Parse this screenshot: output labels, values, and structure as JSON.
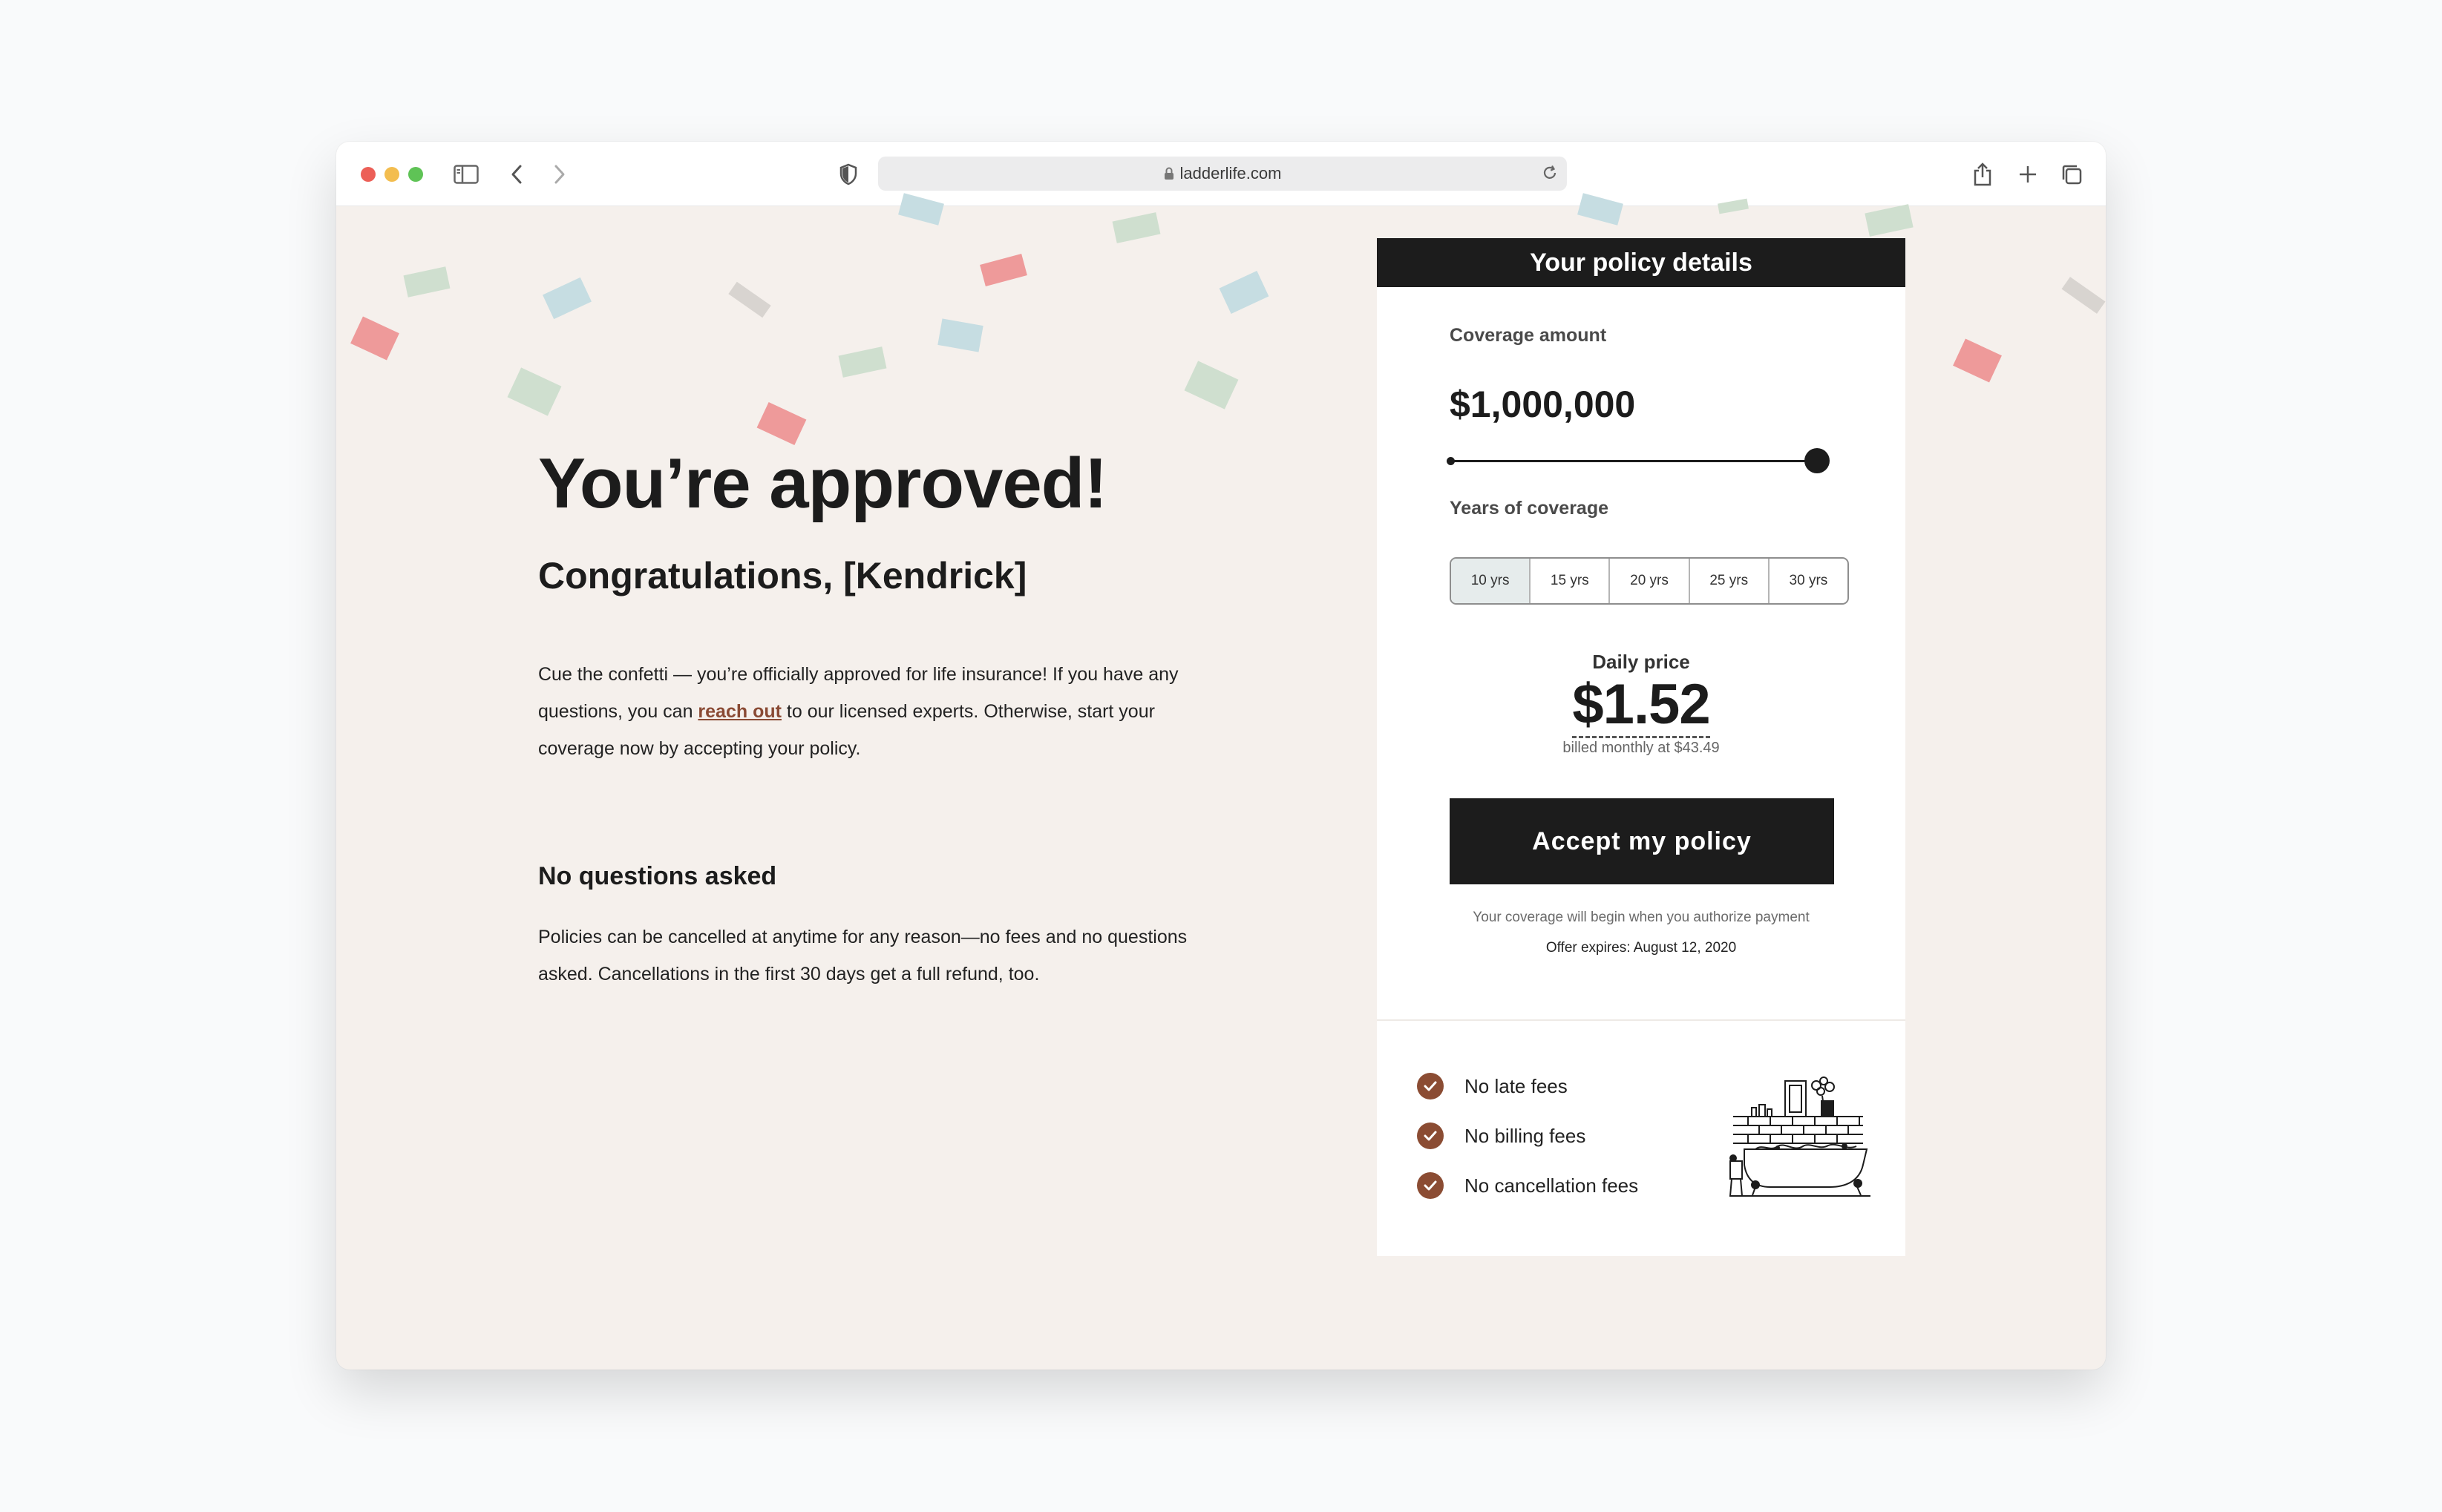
{
  "browser": {
    "url": "ladderlife.com",
    "controls": {
      "sidebar_icon": "sidebar-icon",
      "back_icon": "chevron-left-icon",
      "forward_icon": "chevron-right-icon",
      "shield_icon": "shield-icon",
      "reload_icon": "reload-icon",
      "share_icon": "share-icon",
      "new_tab_icon": "plus-icon",
      "tabs_icon": "tabs-overview-icon"
    }
  },
  "page": {
    "headline": "You’re approved!",
    "subheadline": "Congratulations, [Kendrick]",
    "intro": {
      "before_link": "Cue the confetti — you’re officially approved for life insurance! If you have any questions, you can ",
      "link_text": "reach out",
      "after_link": " to our licensed experts. Otherwise, start your coverage now by accepting your policy."
    },
    "section_title": "No questions asked",
    "section_text": "Policies can be cancelled at anytime for any reason—no fees and no questions asked. Cancellations in the first 30 days get a full refund, too."
  },
  "policy": {
    "header": "Your policy details",
    "coverage_label": "Coverage amount",
    "coverage_amount": "$1,000,000",
    "coverage_slider_fraction": 1.0,
    "years_label": "Years of coverage",
    "years_options": [
      "10 yrs",
      "15 yrs",
      "20 yrs",
      "25 yrs",
      "30 yrs"
    ],
    "years_selected": "10 yrs",
    "daily_label": "Daily price",
    "daily_price": "$1.52",
    "billed_text": "billed monthly at $43.49",
    "accept_label": "Accept my policy",
    "note": "Your coverage will begin when you authorize payment",
    "offer": "Offer expires: August 12, 2020",
    "features": [
      "No late fees",
      "No billing fees",
      "No cancellation fees"
    ],
    "check_icon": "check-icon",
    "illustration": "bathtub-illustration"
  },
  "colors": {
    "background": "#f5f0ec",
    "dark": "#1c1c1c",
    "accent_brown": "#8b4c33",
    "confetti_red": "#ee9a9a",
    "confetti_green": "#cfdfcf",
    "confetti_blue": "#c6dde2",
    "confetti_grey": "#d8d4d0"
  }
}
